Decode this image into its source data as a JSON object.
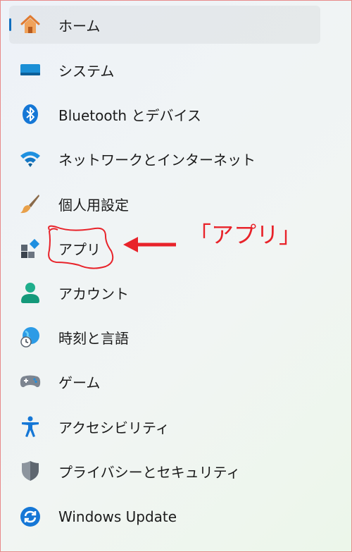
{
  "nav": {
    "items": [
      {
        "label": "ホーム",
        "icon": "home-icon",
        "selected": true
      },
      {
        "label": "システム",
        "icon": "system-display-icon"
      },
      {
        "label": "Bluetooth とデバイス",
        "icon": "bluetooth-icon"
      },
      {
        "label": "ネットワークとインターネット",
        "icon": "wifi-icon"
      },
      {
        "label": "個人用設定",
        "icon": "paintbrush-icon"
      },
      {
        "label": "アプリ",
        "icon": "apps-icon"
      },
      {
        "label": "アカウント",
        "icon": "account-icon"
      },
      {
        "label": "時刻と言語",
        "icon": "globe-clock-icon"
      },
      {
        "label": "ゲーム",
        "icon": "gamepad-icon"
      },
      {
        "label": "アクセシビリティ",
        "icon": "accessibility-icon"
      },
      {
        "label": "プライバシーとセキュリティ",
        "icon": "shield-icon"
      },
      {
        "label": "Windows Update",
        "icon": "windows-update-icon"
      }
    ]
  },
  "annotation": {
    "text": "「アプリ」",
    "color": "#e8232a"
  },
  "colors": {
    "accent": "#106ebe"
  }
}
